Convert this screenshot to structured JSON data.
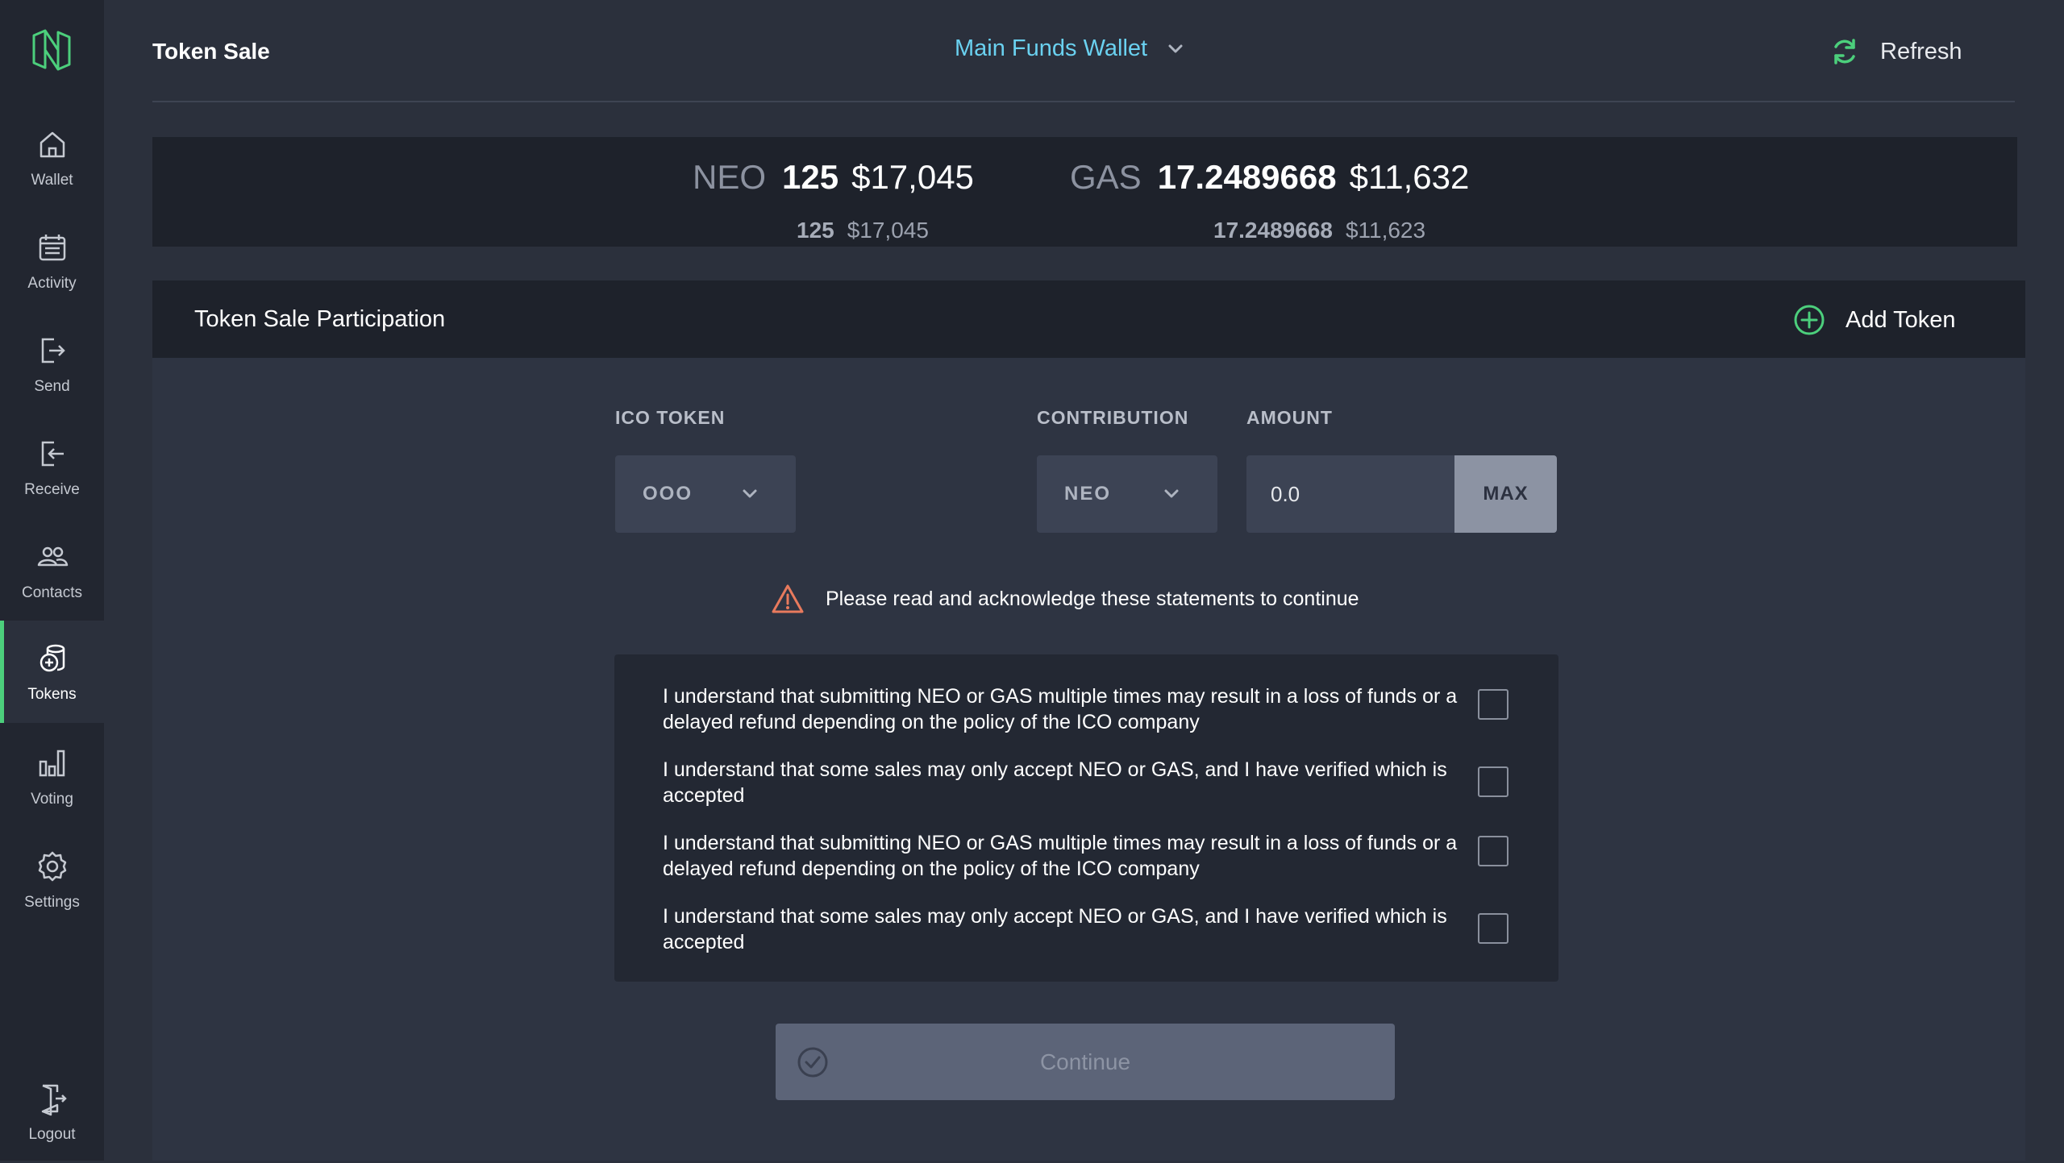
{
  "sidebar": {
    "items": [
      {
        "label": "Wallet",
        "icon": "home-icon"
      },
      {
        "label": "Activity",
        "icon": "calendar-icon"
      },
      {
        "label": "Send",
        "icon": "send-icon"
      },
      {
        "label": "Receive",
        "icon": "receive-icon"
      },
      {
        "label": "Contacts",
        "icon": "contacts-icon"
      },
      {
        "label": "Tokens",
        "icon": "tokens-icon",
        "active": true
      },
      {
        "label": "Voting",
        "icon": "bar-chart-icon"
      },
      {
        "label": "Settings",
        "icon": "gear-icon"
      }
    ],
    "logout": {
      "label": "Logout",
      "icon": "logout-icon"
    }
  },
  "header": {
    "title": "Token Sale",
    "wallet": "Main Funds Wallet",
    "refresh": "Refresh"
  },
  "balances": {
    "neo": {
      "symbol": "NEO",
      "amount": "125",
      "usd": "$17,045",
      "sub_amount": "125",
      "sub_usd": "$17,045"
    },
    "gas": {
      "symbol": "GAS",
      "amount": "17.2489668",
      "usd": "$11,632",
      "sub_amount": "17.2489668",
      "sub_usd": "$11,623"
    }
  },
  "panel": {
    "title": "Token Sale Participation",
    "add_token": "Add Token"
  },
  "form": {
    "ico_token_label": "ICO TOKEN",
    "ico_token_value": "OOO",
    "contribution_label": "CONTRIBUTION",
    "contribution_value": "NEO",
    "amount_label": "AMOUNT",
    "amount_value": "0.0",
    "max_label": "MAX"
  },
  "warning": "Please read and acknowledge these statements to continue",
  "statements": [
    {
      "text": "I understand that submitting NEO or GAS multiple times may result in a loss of funds or a delayed refund depending on the policy of the ICO company",
      "checked": false
    },
    {
      "text": "I understand that some sales may only accept NEO or GAS, and I have verified which is accepted",
      "checked": false
    },
    {
      "text": "I understand that submitting NEO or GAS multiple times may result in a loss of funds or a delayed refund depending on the policy of the ICO company",
      "checked": false
    },
    {
      "text": "I understand that some sales may only accept NEO or GAS, and I have verified which is accepted",
      "checked": false
    }
  ],
  "continue_label": "Continue",
  "colors": {
    "accent_green": "#4ccf7c",
    "wallet_blue": "#6ad1f0",
    "warning_orange": "#e87a5d"
  }
}
